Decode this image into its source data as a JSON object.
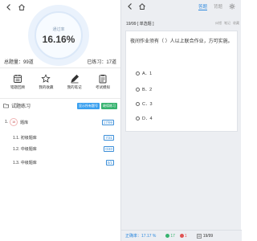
{
  "left": {
    "rate_label": "通过率",
    "rate_value": "16.16%",
    "total_label": "总题量：99道",
    "done_label": "已练习：17道",
    "features": [
      {
        "label": "错题回顾",
        "icon": "calendar-icon"
      },
      {
        "label": "我的收藏",
        "icon": "star-icon"
      },
      {
        "label": "我的笔记",
        "icon": "pen-icon"
      },
      {
        "label": "考试模拟",
        "icon": "clipboard-icon"
      }
    ],
    "section_title": "试题练习",
    "badge_show_practiced": "显示所有题号",
    "badge_continue": "继续练习",
    "chapter": {
      "prefix": "1.",
      "icon_num": "16",
      "label": "题库",
      "count": "17/99"
    },
    "subchapters": [
      {
        "label": "1.1. 初级题库",
        "count": "7/31"
      },
      {
        "label": "1.2. 中级题库",
        "count": "0/40"
      },
      {
        "label": "1.3. 中级题库",
        "count": "0/1"
      }
    ]
  },
  "right": {
    "tab_answer": "答题",
    "tab_memorize": "背题",
    "question_header": "19/99 [ 单选题 ]",
    "actions": [
      "纠错",
      "笔记",
      "收藏"
    ],
    "question_text": "夜间作业须有（ ）人以上联合作业，方可实施。",
    "options": [
      {
        "label": "A．1"
      },
      {
        "label": "B．2"
      },
      {
        "label": "C．3"
      },
      {
        "label": "D．4"
      }
    ],
    "footer": {
      "accuracy": "正确率：17.17 %",
      "correct": "17",
      "wrong": "1",
      "progress": "19/99"
    },
    "colors": {
      "accent": "#2d89de",
      "correct": "#37b36f",
      "wrong": "#e05252"
    }
  }
}
